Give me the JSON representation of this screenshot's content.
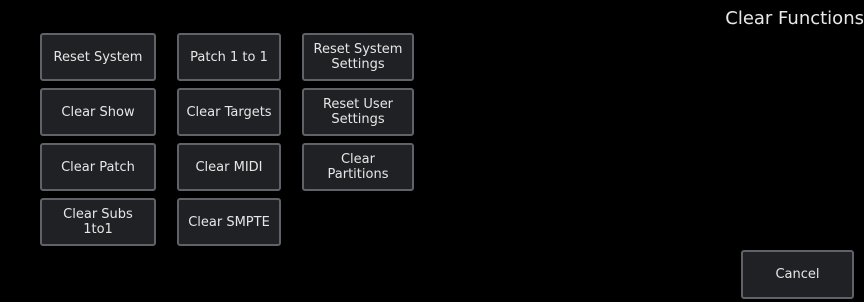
{
  "header": {
    "title": "Clear Functions"
  },
  "buttons": {
    "reset_system": "Reset System",
    "patch_1_to_1": "Patch 1 to 1",
    "reset_system_settings": "Reset System\nSettings",
    "clear_show": "Clear Show",
    "clear_targets": "Clear Targets",
    "reset_user_settings": "Reset User\nSettings",
    "clear_patch": "Clear Patch",
    "clear_midi": "Clear MIDI",
    "clear_partitions": "Clear\nPartitions",
    "clear_subs_1to1": "Clear Subs\n1to1",
    "clear_smpte": "Clear SMPTE"
  },
  "footer": {
    "cancel_label": "Cancel"
  },
  "colors": {
    "background": "#000000",
    "button_fill": "#1f2124",
    "button_border": "#5f6266",
    "text": "#e6e6e6"
  }
}
